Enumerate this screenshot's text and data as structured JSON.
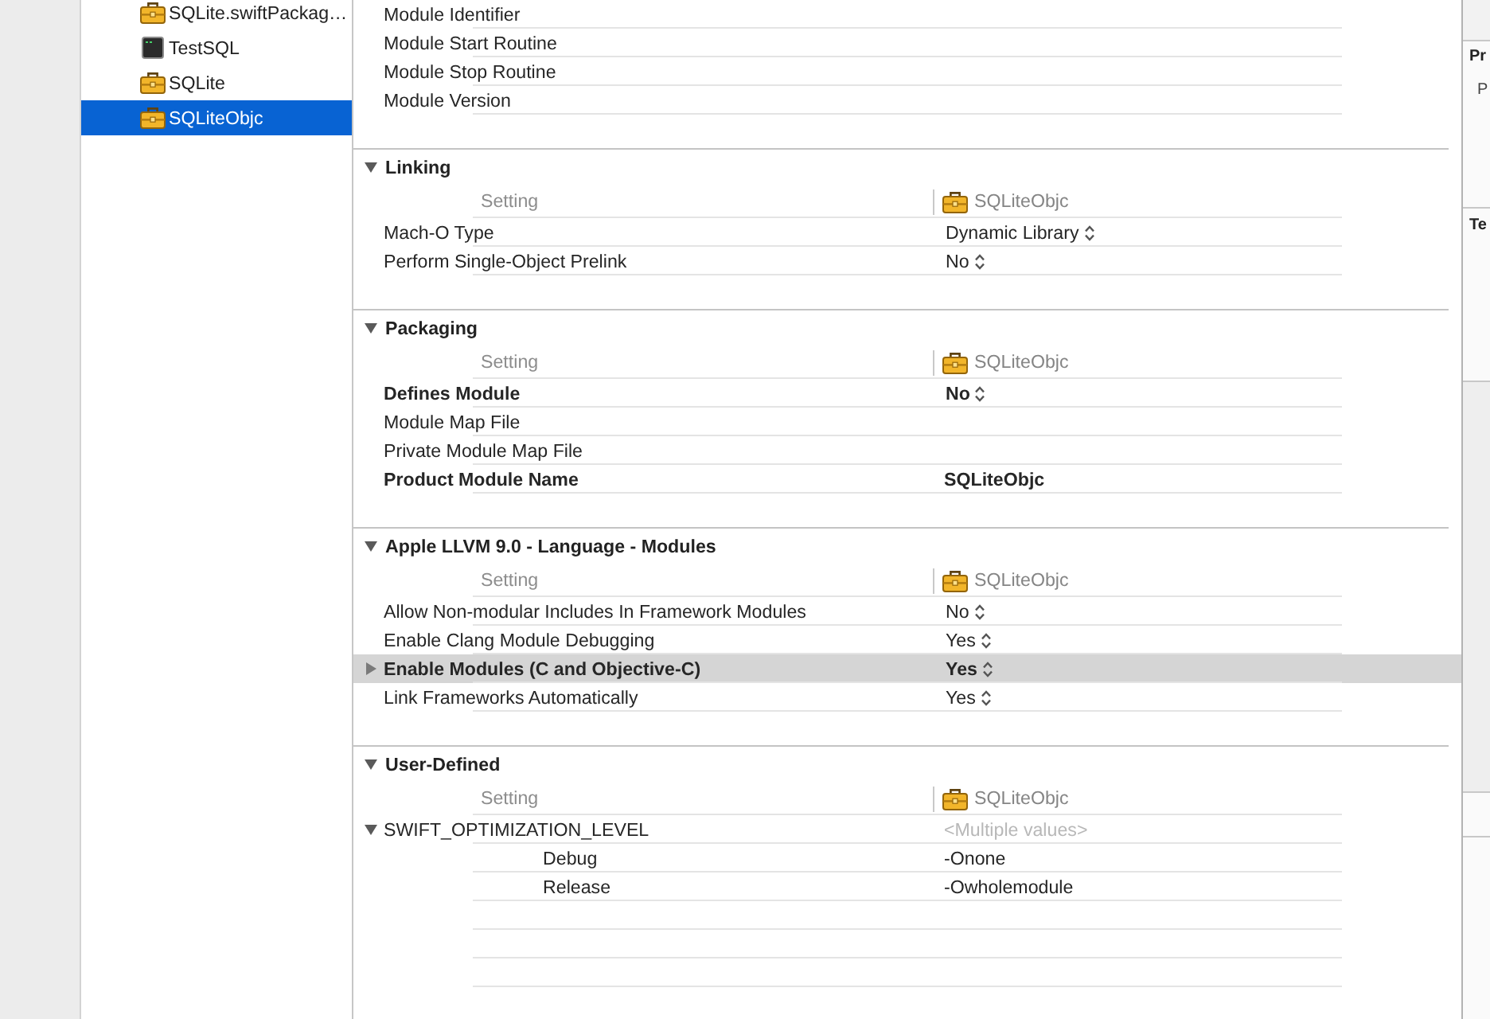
{
  "sidebar": {
    "items": [
      {
        "label": "SQLite.swiftPackag…",
        "kind": "framework",
        "selected": false
      },
      {
        "label": "TestSQL",
        "kind": "tool",
        "selected": false
      },
      {
        "label": "SQLite",
        "kind": "framework",
        "selected": false
      },
      {
        "label": "SQLiteObjc",
        "kind": "framework",
        "selected": true
      }
    ]
  },
  "build_settings": {
    "sections": [
      {
        "rows": [
          {
            "label": "Module Identifier",
            "customized": false,
            "selected": false
          },
          {
            "label": "Module Start Routine",
            "customized": false,
            "selected": false
          },
          {
            "label": "Module Stop Routine",
            "customized": false,
            "selected": false
          },
          {
            "label": "Module Version",
            "customized": false,
            "selected": false
          }
        ]
      },
      {
        "title": "Linking",
        "expanded": true,
        "columns": {
          "setting": "Setting",
          "target": "SQLiteObjc"
        },
        "rows": [
          {
            "label": "Mach-O Type",
            "value": "Dynamic Library",
            "popup": true,
            "customized": false,
            "selected": false
          },
          {
            "label": "Perform Single-Object Prelink",
            "value": "No",
            "popup": true,
            "customized": false,
            "selected": false
          }
        ]
      },
      {
        "title": "Packaging",
        "expanded": true,
        "columns": {
          "setting": "Setting",
          "target": "SQLiteObjc"
        },
        "rows": [
          {
            "label": "Defines Module",
            "value": "No",
            "popup": true,
            "customized": true,
            "selected": false
          },
          {
            "label": "Module Map File",
            "customized": false,
            "selected": false
          },
          {
            "label": "Private Module Map File",
            "customized": false,
            "selected": false
          },
          {
            "label": "Product Module Name",
            "value": "SQLiteObjc",
            "popup": false,
            "customized": true,
            "selected": false
          }
        ]
      },
      {
        "title": "Apple LLVM 9.0 - Language - Modules",
        "expanded": true,
        "columns": {
          "setting": "Setting",
          "target": "SQLiteObjc"
        },
        "rows": [
          {
            "label": "Allow Non-modular Includes In Framework Modules",
            "value": "No",
            "popup": true,
            "customized": false,
            "selected": false
          },
          {
            "label": "Enable Clang Module Debugging",
            "value": "Yes",
            "popup": true,
            "customized": false,
            "selected": false
          },
          {
            "label": "Enable Modules (C and Objective-C)",
            "value": "Yes",
            "popup": true,
            "customized": true,
            "selected": true,
            "expanded": false
          },
          {
            "label": "Link Frameworks Automatically",
            "value": "Yes",
            "popup": true,
            "customized": false,
            "selected": false
          }
        ]
      },
      {
        "title": "User-Defined",
        "expanded": true,
        "columns": {
          "setting": "Setting",
          "target": "SQLiteObjc"
        },
        "rows": [
          {
            "label": "SWIFT_OPTIMIZATION_LEVEL",
            "placeholder": "<Multiple values>",
            "customized": false,
            "selected": false,
            "expanded": true,
            "children": [
              {
                "label": "Debug",
                "value": "-Onone",
                "popup": false,
                "customized": false,
                "selected": false
              },
              {
                "label": "Release",
                "value": "-Owholemodule",
                "popup": false,
                "customized": false,
                "selected": false
              }
            ]
          }
        ]
      }
    ]
  },
  "inspector": {
    "sections": [
      {
        "title": "Pr",
        "items": [
          "P"
        ]
      },
      {
        "title": "Te"
      }
    ]
  }
}
